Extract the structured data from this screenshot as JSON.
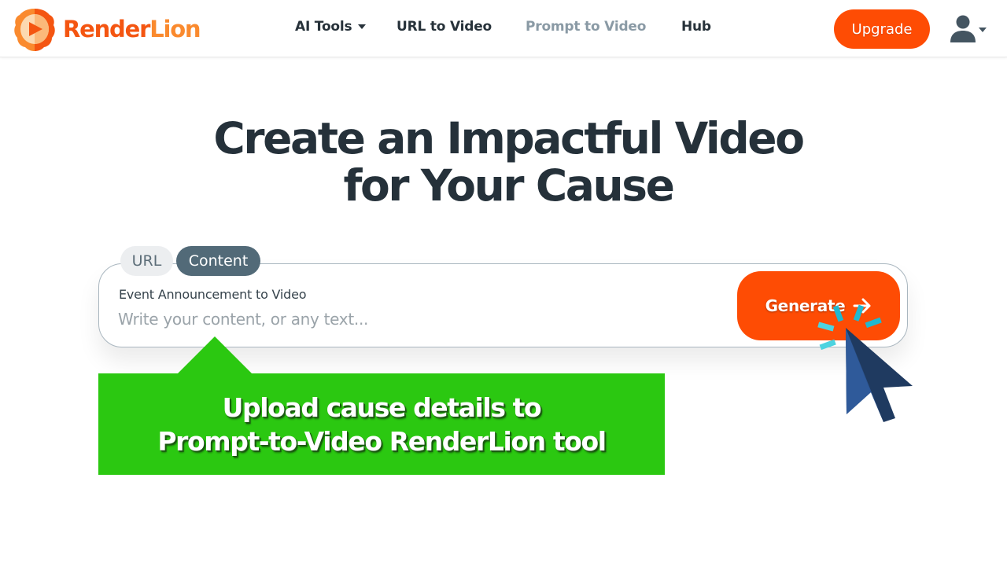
{
  "brand": {
    "name_part1": "Render",
    "name_part2": "Lion",
    "logo_icon": "lion-play-icon",
    "primary_color": "#fe4c04",
    "secondary_color": "#fa8a2e"
  },
  "nav": {
    "items": [
      {
        "label": "AI Tools",
        "has_dropdown": true,
        "state": "default"
      },
      {
        "label": "URL to Video",
        "state": "default"
      },
      {
        "label": "Prompt to Video",
        "state": "muted"
      },
      {
        "label": "Hub",
        "state": "default"
      }
    ],
    "upgrade_label": "Upgrade",
    "user_icon": "user-icon"
  },
  "hero": {
    "title_line1": "Create an Impactful Video",
    "title_line2": "for Your Cause"
  },
  "input_card": {
    "tabs": [
      {
        "label": "URL",
        "active": false
      },
      {
        "label": "Content",
        "active": true
      }
    ],
    "label": "Event Announcement to Video",
    "placeholder": "Write your content, or any text...",
    "value": "",
    "generate_label": "Generate",
    "generate_icon": "arrow-right-icon"
  },
  "annotation": {
    "line1": "Upload cause details to",
    "line2": "Prompt-to-Video RenderLion tool",
    "color": "#2bc811"
  }
}
